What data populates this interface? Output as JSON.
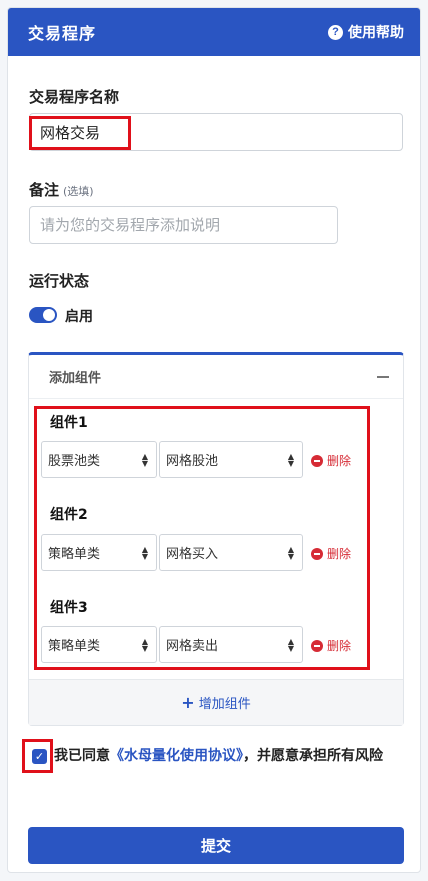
{
  "header": {
    "title": "交易程序",
    "help_label": "使用帮助",
    "help_icon": "question-circle-icon"
  },
  "form": {
    "name_label": "交易程序名称",
    "name_value": "网格交易",
    "note_label": "备注",
    "note_hint": "(选填)",
    "note_placeholder": "请为您的交易程序添加说明",
    "status_label": "运行状态",
    "status_toggle_label": "启用",
    "status_enabled": true
  },
  "components": {
    "panel_title": "添加组件",
    "add_label": "增加组件",
    "delete_label": "删除",
    "items": [
      {
        "title": "组件1",
        "type": "股票池类",
        "value": "网格股池"
      },
      {
        "title": "组件2",
        "type": "策略单类",
        "value": "网格买入"
      },
      {
        "title": "组件3",
        "type": "策略单类",
        "value": "网格卖出"
      }
    ]
  },
  "agreement": {
    "prefix": "我已同意",
    "link": "《水母量化使用协议》",
    "suffix": "，并愿意承担所有风险",
    "checked": true
  },
  "submit_label": "提交",
  "colors": {
    "primary": "#2a55c2",
    "danger": "#d62b35",
    "highlight": "#e0101a"
  }
}
